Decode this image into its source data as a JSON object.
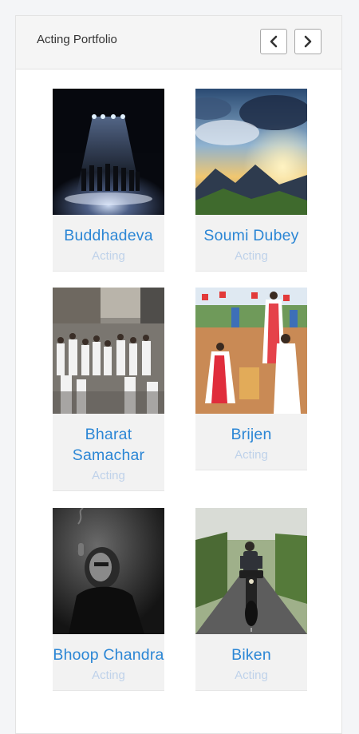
{
  "header": {
    "title": "Acting Portfolio",
    "prev_icon": "chevron-left-icon",
    "next_icon": "chevron-right-icon"
  },
  "colors": {
    "name": "#2b86d5",
    "category": "#bfd2ea"
  },
  "cards": [
    {
      "name": "Buddhadeva",
      "category": "Acting",
      "image": "stage-performance-dark"
    },
    {
      "name": "Soumi Dubey",
      "category": "Acting",
      "image": "mountain-sunrise-sky"
    },
    {
      "name": "Bharat Samachar",
      "category": "Acting",
      "image": "street-crowd"
    },
    {
      "name": "Brijen",
      "category": "Acting",
      "image": "dance-festival"
    },
    {
      "name": "Bhoop Chandra",
      "category": "Acting",
      "image": "bw-portrait-smoking"
    },
    {
      "name": "Biken",
      "category": "Acting",
      "image": "motorcycle-rider-road"
    }
  ]
}
